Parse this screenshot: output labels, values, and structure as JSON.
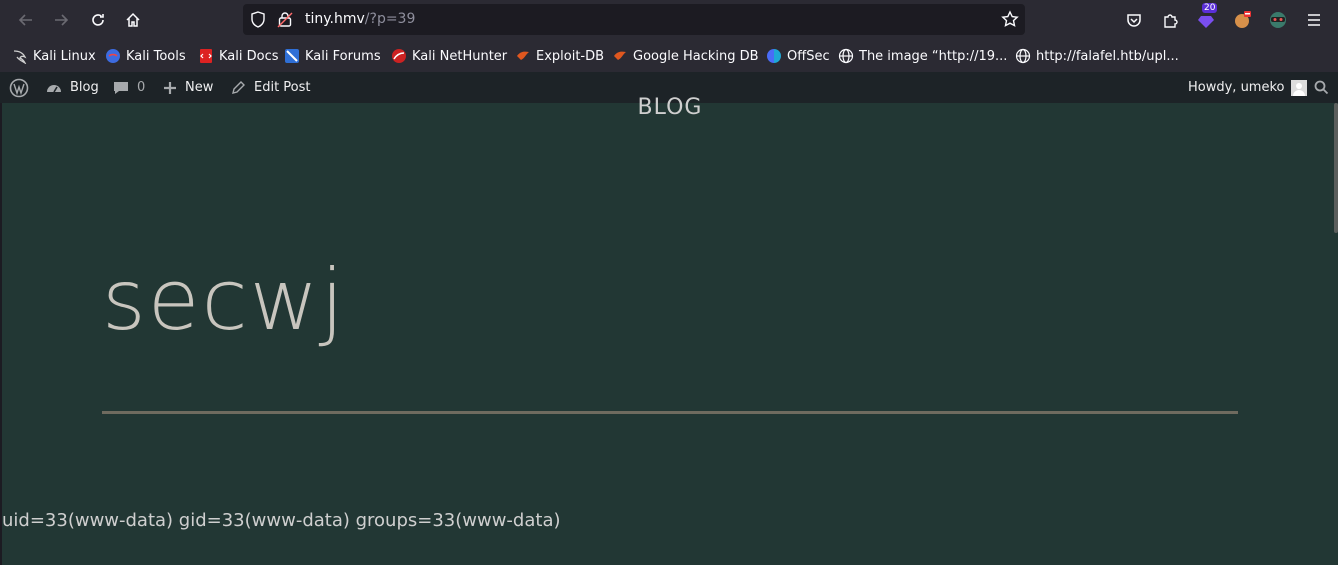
{
  "browser": {
    "url_host": "tiny.hmv",
    "url_path": "/?p=39",
    "extensions_badge": "20"
  },
  "bookmarks": [
    {
      "label": "Kali Linux"
    },
    {
      "label": "Kali Tools"
    },
    {
      "label": "Kali Docs"
    },
    {
      "label": "Kali Forums"
    },
    {
      "label": "Kali NetHunter"
    },
    {
      "label": "Exploit-DB"
    },
    {
      "label": "Google Hacking DB"
    },
    {
      "label": "OffSec"
    },
    {
      "label": "The image “http://19..."
    },
    {
      "label": "http://falafel.htb/upl..."
    }
  ],
  "adminbar": {
    "site_label": "Blog",
    "comments_count": "0",
    "new_label": "New",
    "edit_label": "Edit Post",
    "howdy": "Howdy, umeko"
  },
  "page": {
    "site_title": "BLOG",
    "post_title": "secwj",
    "output": "uid=33(www-data) gid=33(www-data) groups=33(www-data)"
  },
  "colors": {
    "content_bg": "#223734",
    "adminbar_bg": "#1d2327",
    "toolbar_bg": "#2b2a33"
  }
}
